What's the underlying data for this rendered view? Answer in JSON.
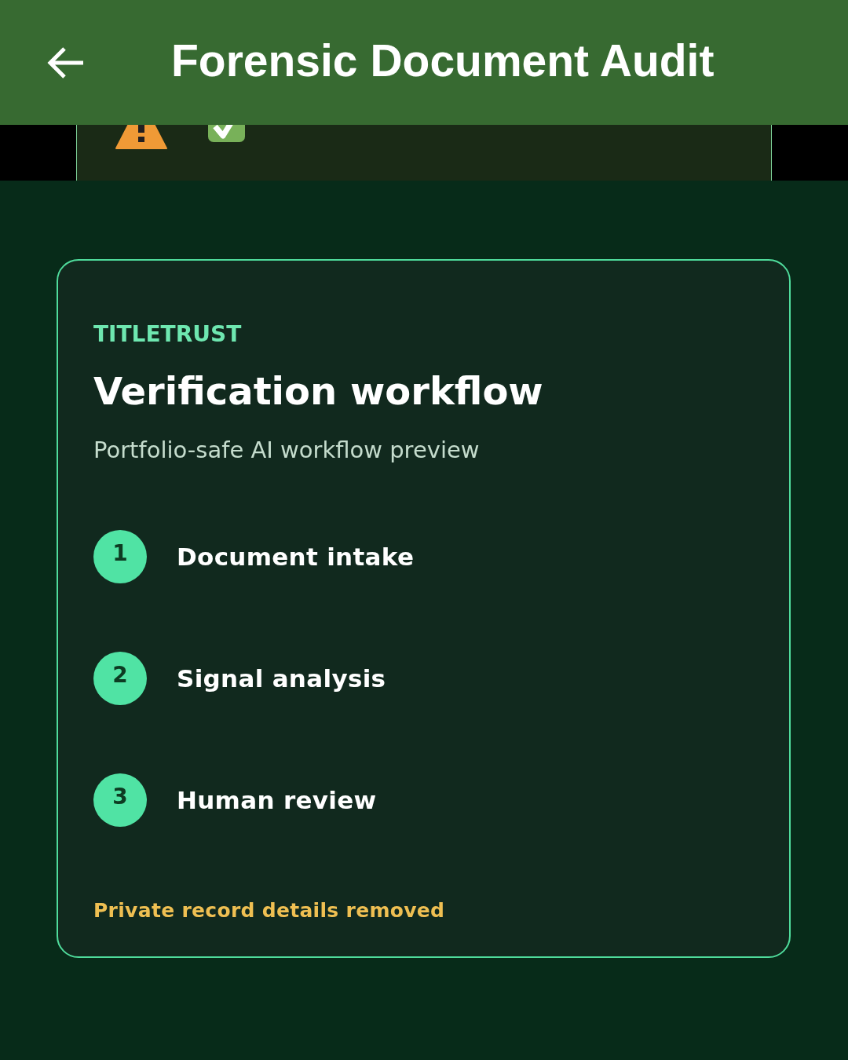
{
  "app_bar": {
    "title": "Forensic Document Audit"
  },
  "card": {
    "eyebrow": "TITLETRUST",
    "title": "Verification workflow",
    "subtitle": "Portfolio-safe AI workflow preview",
    "steps": [
      {
        "number": "1",
        "label": "Document intake"
      },
      {
        "number": "2",
        "label": "Signal analysis"
      },
      {
        "number": "3",
        "label": "Human review"
      }
    ],
    "footer_note": "Private record details removed"
  }
}
